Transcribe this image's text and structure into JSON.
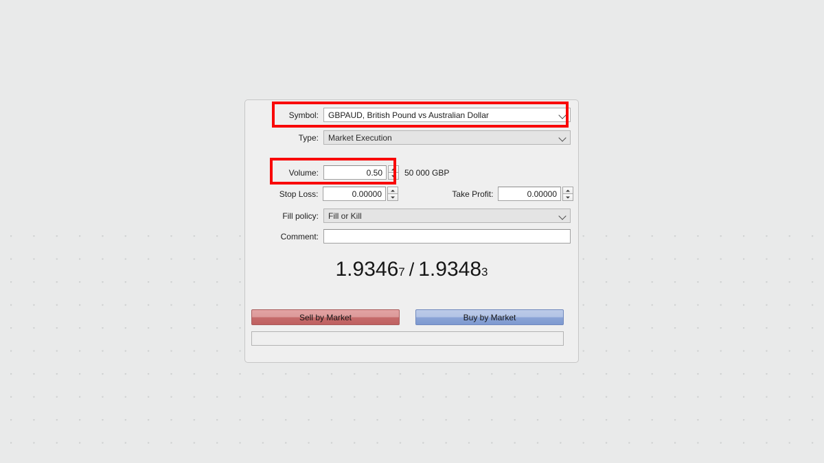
{
  "background": {
    "canvas_color": "#e9eaea",
    "grid_dot_color": "#cfd1d1"
  },
  "dialog": {
    "panel_color": "#efefef",
    "border_color": "#c6c6c6",
    "fields": {
      "symbol": {
        "label": "Symbol:",
        "value": "GBPAUD, British Pound vs Australian Dollar",
        "control": "combobox",
        "state": "enabled",
        "chevron_icon": "chevron-down-icon"
      },
      "type": {
        "label": "Type:",
        "value": "Market Execution",
        "control": "combobox",
        "state": "disabled",
        "chevron_icon": "chevron-down-icon"
      },
      "volume": {
        "label": "Volume:",
        "value": "0.50",
        "control": "spinbox",
        "note": "50 000 GBP"
      },
      "stop_loss": {
        "label": "Stop Loss:",
        "value": "0.00000",
        "control": "spinbox"
      },
      "take_profit": {
        "label": "Take Profit:",
        "value": "0.00000",
        "control": "spinbox"
      },
      "fill_policy": {
        "label": "Fill policy:",
        "value": "Fill or Kill",
        "control": "combobox",
        "state": "disabled",
        "chevron_icon": "chevron-down-icon"
      },
      "comment": {
        "label": "Comment:",
        "value": "",
        "control": "textbox",
        "placeholder": ""
      }
    },
    "quote": {
      "bid_main": "1.9346",
      "bid_fraction": "7",
      "separator": "/",
      "ask_main": "1.9348",
      "ask_fraction": "3",
      "text_color": "#161616"
    },
    "buttons": {
      "sell": {
        "label": "Sell by Market",
        "color": "#c56b6b"
      },
      "buy": {
        "label": "Buy by Market",
        "color": "#8ba4d6"
      }
    },
    "status_bar": {
      "text": ""
    }
  },
  "annotations": {
    "color": "#f90606",
    "boxes": [
      {
        "target": "symbol-field"
      },
      {
        "target": "volume-field"
      }
    ]
  }
}
